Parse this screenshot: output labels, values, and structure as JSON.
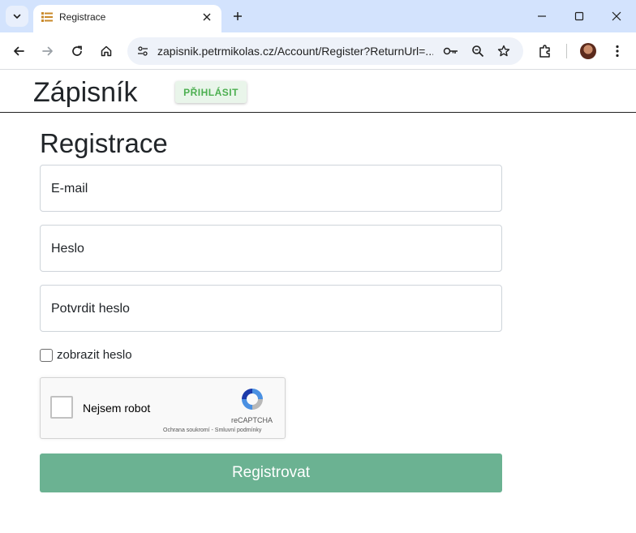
{
  "browser": {
    "tab_title": "Registrace",
    "url": "zapisnik.petrmikolas.cz/Account/Register?ReturnUrl=..."
  },
  "site": {
    "brand": "Zápisník",
    "login_label": "PŘIHLÁSIT"
  },
  "form": {
    "title": "Registrace",
    "email_placeholder": "E-mail",
    "password_placeholder": "Heslo",
    "confirm_placeholder": "Potvrdit heslo",
    "show_password_label": "zobrazit heslo",
    "submit_label": "Registrovat"
  },
  "recaptcha": {
    "label": "Nejsem robot",
    "brand": "reCAPTCHA",
    "terms": "Ochrana soukromí - Smluvní podmínky"
  },
  "colors": {
    "tabbar": "#d3e3fd",
    "login_text": "#4caf50",
    "submit_bg": "#6bb292"
  }
}
